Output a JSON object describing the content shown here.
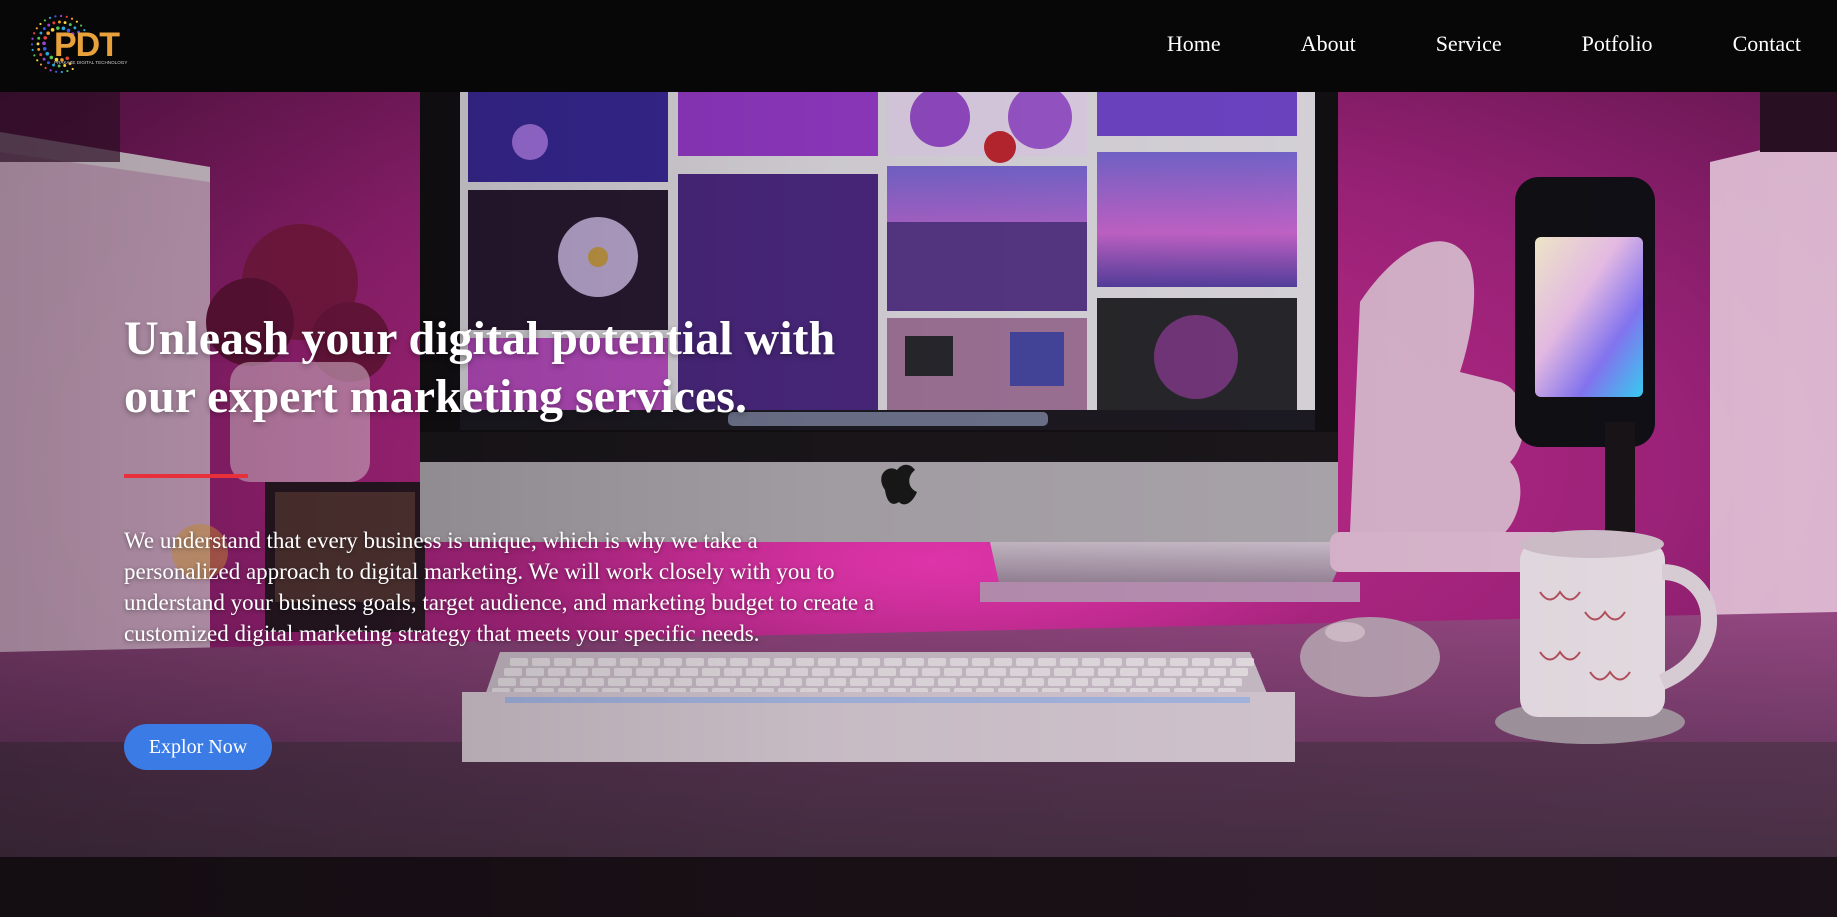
{
  "header": {
    "logo": {
      "text": "PDT",
      "subtext": "PRAKAZE DIGITAL TECHNOLOGY",
      "icon": "dotted-circle-logo-icon"
    },
    "nav": [
      {
        "label": "Home"
      },
      {
        "label": "About"
      },
      {
        "label": "Service"
      },
      {
        "label": "Potfolio"
      },
      {
        "label": "Contact"
      }
    ]
  },
  "hero": {
    "title": "Unleash your digital potential with our expert marketing services.",
    "description": "We understand that every business is unique, which is why we take a personalized approach to digital marketing. We will work closely with you to understand your business goals, target audience, and marketing budget to create a customized digital marketing strategy that meets your specific needs.",
    "cta_label": "Explor Now",
    "background_image": "desk-setup-with-imac-keyboard-phone-and-mug-in-pink-light"
  },
  "colors": {
    "header_bg": "#070707",
    "accent_line": "#e8303a",
    "cta_bg": "#3a7be6",
    "text": "#ffffff",
    "scene_pink": "#c0309a"
  }
}
